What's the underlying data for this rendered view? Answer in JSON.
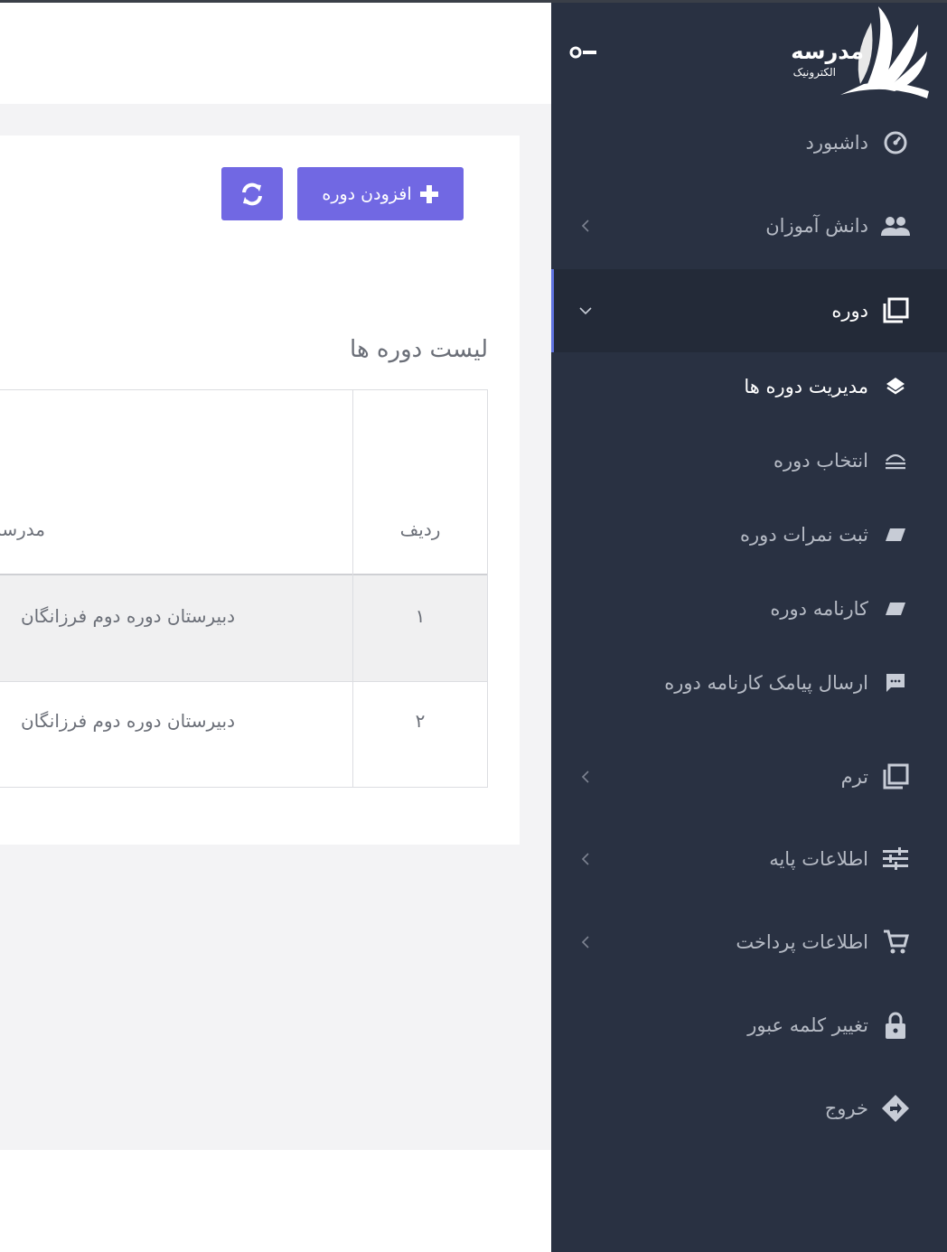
{
  "sidebar": {
    "logo": {
      "title": "مدرسه",
      "subtitle": "الکترونیک"
    },
    "items": [
      {
        "label": "داشبورد",
        "icon": "dashboard-icon"
      },
      {
        "label": "دانش آموزان",
        "icon": "users-icon"
      },
      {
        "label": "دوره",
        "icon": "course-icon"
      },
      {
        "label": "مدیریت دوره ها",
        "icon": "layers-icon"
      },
      {
        "label": "انتخاب دوره",
        "icon": "select-icon"
      },
      {
        "label": "ثبت نمرات دوره",
        "icon": "tag-icon"
      },
      {
        "label": "کارنامه دوره",
        "icon": "tag-icon"
      },
      {
        "label": "ارسال پیامک کارنامه دوره",
        "icon": "sms-icon"
      },
      {
        "label": "ترم",
        "icon": "term-icon"
      },
      {
        "label": "اطلاعات پایه",
        "icon": "sliders-icon"
      },
      {
        "label": "اطلاعات پرداخت",
        "icon": "cart-icon"
      },
      {
        "label": "تغییر کلمه عبور",
        "icon": "lock-icon"
      },
      {
        "label": "خروج",
        "icon": "exit-icon"
      }
    ]
  },
  "toolbar": {
    "add_label": "افزودن دوره"
  },
  "main": {
    "card_title": "لیست دوره ها",
    "table": {
      "columns": [
        "ردیف",
        "مدرسه"
      ],
      "rows": [
        {
          "index": "۱",
          "school": "دبیرستان دوره دوم فرزانگان"
        },
        {
          "index": "۲",
          "school": "دبیرستان دوره دوم فرزانگان"
        }
      ]
    }
  },
  "colors": {
    "sidebar_bg": "#293142",
    "accent": "#7168e3",
    "active_bar": "#5f73e0"
  }
}
